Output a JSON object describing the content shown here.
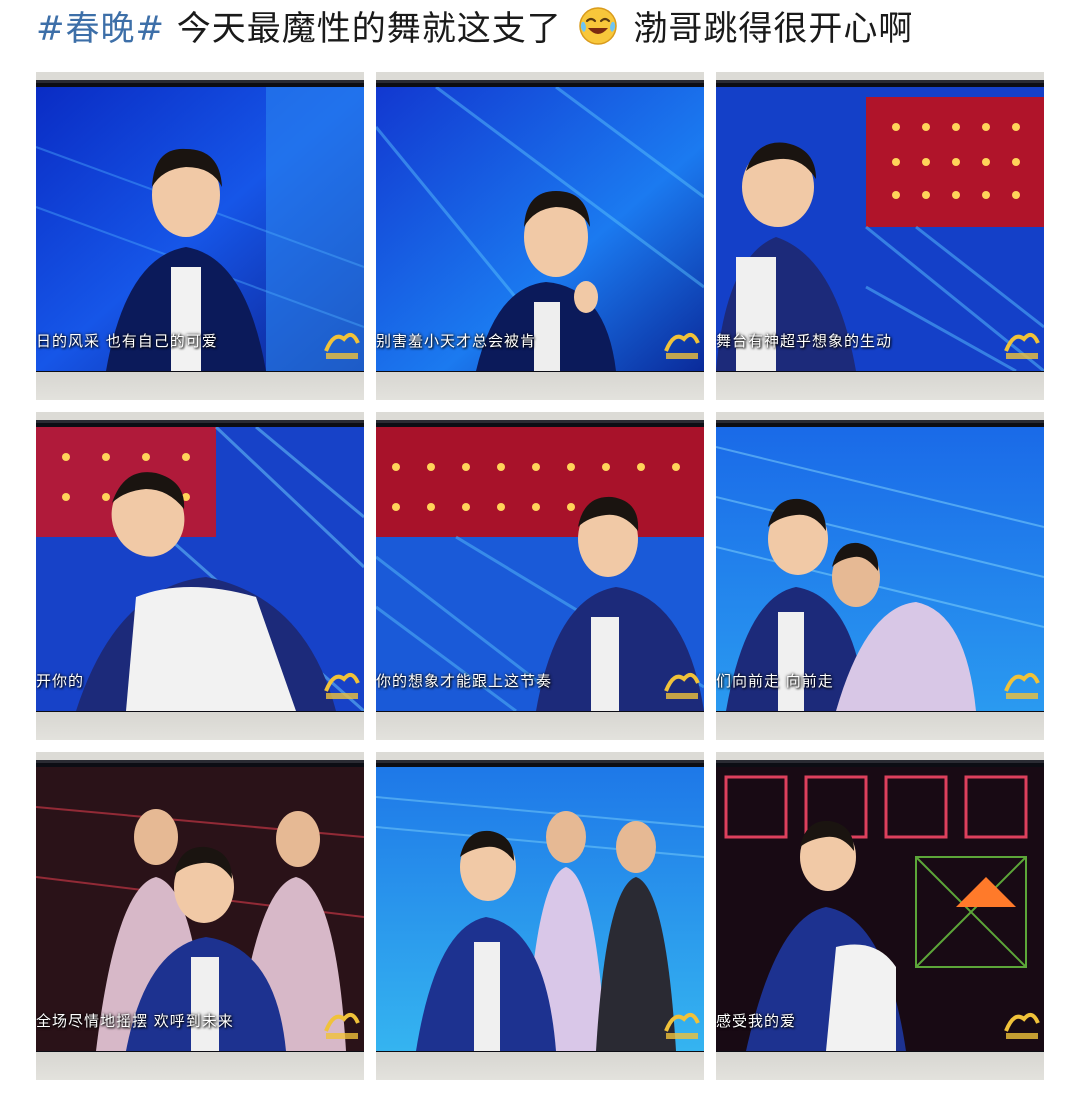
{
  "post": {
    "hashtag": "#春晚#",
    "text_before_emoji": "今天最魔性的舞就这支了",
    "emoji_icon": "laughing-crying-face-icon",
    "text_after_emoji": "渤哥跳得很开心啊"
  },
  "colors": {
    "hashtag": "#3d6fa8",
    "text": "#1a1a1a"
  },
  "photos": [
    {
      "subtitle": "日的风采 也有自己的可爱",
      "scene": "blue-stage"
    },
    {
      "subtitle": "别害羞小天才总会被肯",
      "scene": "blue-stage"
    },
    {
      "subtitle": "舞台有神超乎想象的生动",
      "scene": "red-lights"
    },
    {
      "subtitle": "开你的",
      "scene": "red-blue"
    },
    {
      "subtitle": "你的想象才能跟上这节奏",
      "scene": "red-lights"
    },
    {
      "subtitle": "们向前走 向前走",
      "scene": "blue-stage"
    },
    {
      "subtitle": "全场尽情地摇摆 欢呼到未来",
      "scene": "dark-dancers"
    },
    {
      "subtitle": "",
      "scene": "blue-dancers"
    },
    {
      "subtitle": "感受我的爱",
      "scene": "neon"
    }
  ]
}
